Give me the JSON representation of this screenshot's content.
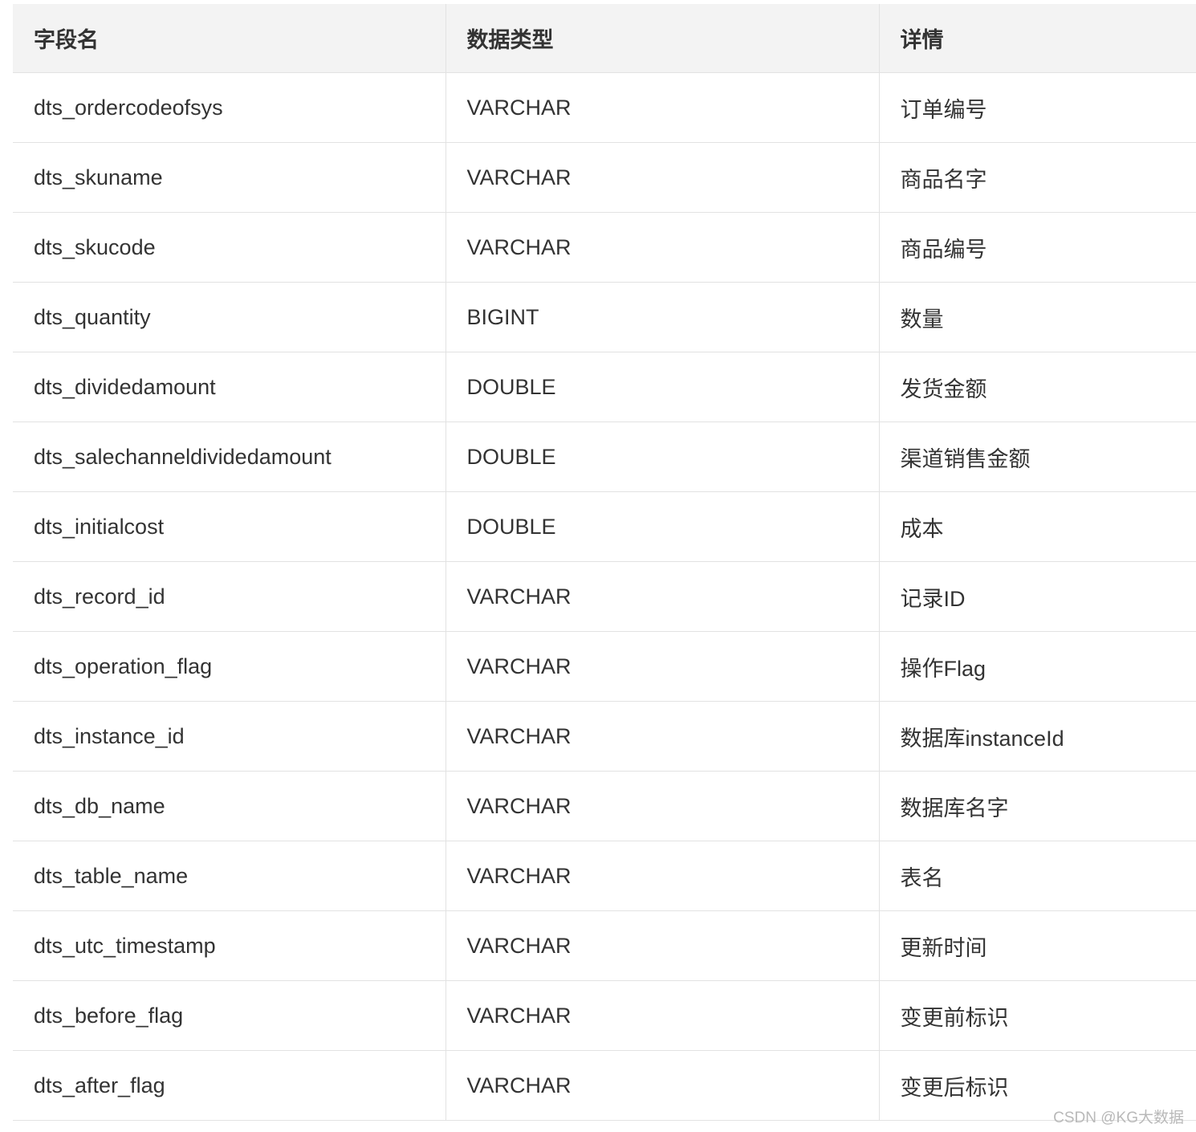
{
  "table": {
    "headers": [
      "字段名",
      "数据类型",
      "详情"
    ],
    "rows": [
      [
        "dts_ordercodeofsys",
        "VARCHAR",
        "订单编号"
      ],
      [
        "dts_skuname",
        "VARCHAR",
        "商品名字"
      ],
      [
        "dts_skucode",
        "VARCHAR",
        "商品编号"
      ],
      [
        "dts_quantity",
        "BIGINT",
        "数量"
      ],
      [
        "dts_dividedamount",
        "DOUBLE",
        "发货金额"
      ],
      [
        "dts_salechanneldividedamount",
        "DOUBLE",
        "渠道销售金额"
      ],
      [
        "dts_initialcost",
        "DOUBLE",
        "成本"
      ],
      [
        "dts_record_id",
        "VARCHAR",
        "记录ID"
      ],
      [
        "dts_operation_flag",
        "VARCHAR",
        "操作Flag"
      ],
      [
        "dts_instance_id",
        "VARCHAR",
        "数据库instanceId"
      ],
      [
        "dts_db_name",
        "VARCHAR",
        "数据库名字"
      ],
      [
        "dts_table_name",
        "VARCHAR",
        "表名"
      ],
      [
        "dts_utc_timestamp",
        "VARCHAR",
        "更新时间"
      ],
      [
        "dts_before_flag",
        "VARCHAR",
        "变更前标识"
      ],
      [
        "dts_after_flag",
        "VARCHAR",
        "变更后标识"
      ]
    ]
  },
  "watermark": "CSDN @KG大数据"
}
